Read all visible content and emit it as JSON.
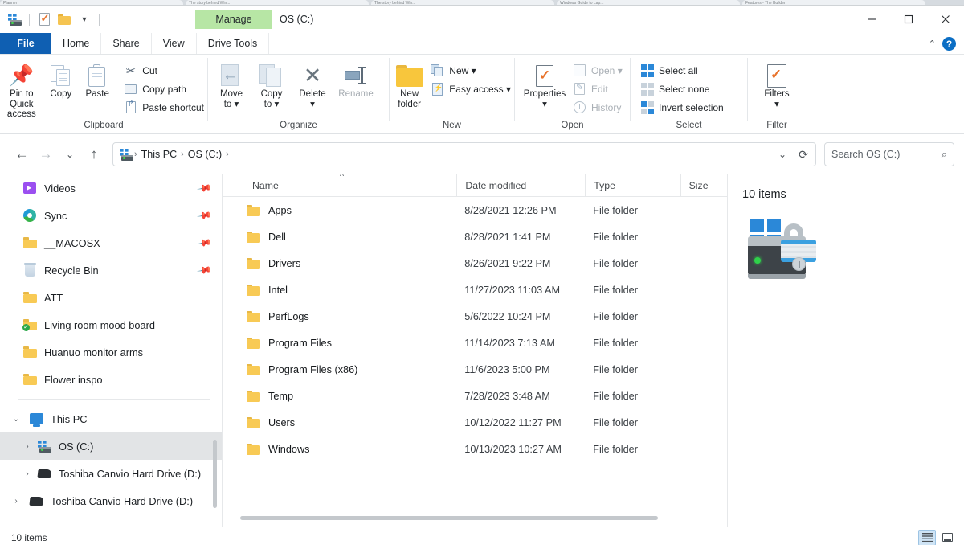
{
  "browser_tabs": [
    {
      "title": "Planner"
    },
    {
      "title": "The story behind Win..."
    },
    {
      "title": "The story behind Win..."
    },
    {
      "title": "Windows Guide to Lap..."
    },
    {
      "title": "Features - The Builder"
    }
  ],
  "window": {
    "title": "OS (C:)",
    "contextual_tab": "Manage",
    "controls": {
      "minimize": "—",
      "maximize": "☐",
      "close": "✕"
    },
    "quick_access": {
      "drive_icon": "drive-icon",
      "properties_icon": "properties-icon",
      "folder_icon": "new-folder-icon",
      "customize_icon": "chevron-down-icon"
    }
  },
  "ribbon": {
    "tabs": [
      {
        "label": "File",
        "state": "file"
      },
      {
        "label": "Home",
        "state": "active"
      },
      {
        "label": "Share",
        "state": "normal"
      },
      {
        "label": "View",
        "state": "normal"
      },
      {
        "label": "Drive Tools",
        "state": "contextual"
      }
    ],
    "collapse_icon": "chevron-up-icon",
    "help_label": "?",
    "groups": [
      {
        "label": "Clipboard",
        "big_buttons": [
          {
            "label": "Pin to Quick\naccess",
            "label_line1": "Pin to Quick",
            "label_line2": "access",
            "icon": "pin-icon",
            "disabled": false
          },
          {
            "label": "Copy",
            "icon": "copy-icon",
            "disabled": false
          },
          {
            "label": "Paste",
            "icon": "paste-icon",
            "disabled": false
          }
        ],
        "small_buttons": [
          {
            "label": "Cut",
            "icon": "scissors-icon",
            "disabled": false
          },
          {
            "label": "Copy path",
            "icon": "copy-path-icon",
            "disabled": false
          },
          {
            "label": "Paste shortcut",
            "icon": "paste-shortcut-icon",
            "disabled": false
          }
        ]
      },
      {
        "label": "Organize",
        "big_buttons": [
          {
            "label_line1": "Move",
            "label_line2": "to ▾",
            "icon": "move-to-icon",
            "disabled": false
          },
          {
            "label_line1": "Copy",
            "label_line2": "to ▾",
            "icon": "copy-to-icon",
            "disabled": false
          },
          {
            "label_line1": "Delete",
            "label_line2": "▾",
            "icon": "delete-icon",
            "disabled": false
          },
          {
            "label_line1": "Rename",
            "label_line2": "",
            "icon": "rename-icon",
            "disabled": true
          }
        ],
        "small_buttons": []
      },
      {
        "label": "New",
        "big_buttons": [
          {
            "label_line1": "New",
            "label_line2": "folder",
            "icon": "new-folder-icon",
            "disabled": false
          }
        ],
        "small_buttons": [
          {
            "label": "New ▾",
            "icon": "new-item-icon",
            "disabled": false
          },
          {
            "label": "Easy access ▾",
            "icon": "easy-access-icon",
            "disabled": false
          }
        ]
      },
      {
        "label": "Open",
        "big_buttons": [
          {
            "label_line1": "Properties",
            "label_line2": "▾",
            "icon": "properties-icon",
            "disabled": false
          }
        ],
        "small_buttons": [
          {
            "label": "Open ▾",
            "icon": "open-icon",
            "disabled": true
          },
          {
            "label": "Edit",
            "icon": "edit-icon",
            "disabled": true
          },
          {
            "label": "History",
            "icon": "history-icon",
            "disabled": true
          }
        ]
      },
      {
        "label": "Select",
        "big_buttons": [],
        "small_buttons": [
          {
            "label": "Select all",
            "icon": "select-all-icon",
            "disabled": false
          },
          {
            "label": "Select none",
            "icon": "select-none-icon",
            "disabled": false
          },
          {
            "label": "Invert selection",
            "icon": "invert-selection-icon",
            "disabled": false
          }
        ]
      },
      {
        "label": "Filter",
        "big_buttons": [
          {
            "label_line1": "Filters",
            "label_line2": "▾",
            "icon": "filters-icon",
            "disabled": false
          }
        ],
        "small_buttons": []
      }
    ]
  },
  "addressbar": {
    "back_icon": "back-arrow-icon",
    "forward_icon": "forward-arrow-icon",
    "recent_icon": "chevron-down-icon",
    "up_icon": "up-arrow-icon",
    "breadcrumbs": [
      "This PC",
      "OS (C:)"
    ],
    "dropdown_icon": "chevron-down-icon",
    "refresh_icon": "refresh-icon",
    "search_placeholder": "Search OS (C:)",
    "search_icon": "search-icon"
  },
  "sidebar": {
    "quick_items": [
      {
        "label": "Videos",
        "icon": "videos-icon",
        "pinned": true
      },
      {
        "label": "Sync",
        "icon": "sync-icon",
        "pinned": true
      },
      {
        "label": "__MACOSX",
        "icon": "folder-icon",
        "pinned": true
      },
      {
        "label": "Recycle Bin",
        "icon": "recycle-bin-icon",
        "pinned": true
      },
      {
        "label": "ATT",
        "icon": "folder-icon",
        "pinned": false
      },
      {
        "label": "Living room mood board",
        "icon": "synced-folder-icon",
        "pinned": false
      },
      {
        "label": "Huanuo monitor arms",
        "icon": "folder-icon",
        "pinned": false
      },
      {
        "label": "Flower inspo",
        "icon": "folder-icon",
        "pinned": false
      }
    ],
    "tree_items": [
      {
        "label": "This PC",
        "icon": "this-pc-icon",
        "level": 0,
        "expanded": true,
        "selected": false
      },
      {
        "label": "OS (C:)",
        "icon": "drive-icon",
        "level": 1,
        "expanded": false,
        "selected": true
      },
      {
        "label": "Toshiba Canvio Hard Drive (D:)",
        "icon": "hdd-icon",
        "level": 1,
        "expanded": false,
        "selected": false
      },
      {
        "label": "Toshiba Canvio Hard Drive (D:)",
        "icon": "hdd-icon",
        "level": 1,
        "expanded": false,
        "selected": false
      }
    ]
  },
  "filelist": {
    "columns": [
      {
        "label": "Name",
        "sorted": true,
        "sort_direction": "asc"
      },
      {
        "label": "Date modified",
        "sorted": false
      },
      {
        "label": "Type",
        "sorted": false
      },
      {
        "label": "Size",
        "sorted": false
      }
    ],
    "sort_indicator": "˄",
    "rows": [
      {
        "name": "Apps",
        "date": "8/28/2021 12:26 PM",
        "type": "File folder",
        "size": "",
        "icon": "folder-icon"
      },
      {
        "name": "Dell",
        "date": "8/28/2021 1:41 PM",
        "type": "File folder",
        "size": "",
        "icon": "folder-icon"
      },
      {
        "name": "Drivers",
        "date": "8/26/2021 9:22 PM",
        "type": "File folder",
        "size": "",
        "icon": "folder-icon"
      },
      {
        "name": "Intel",
        "date": "11/27/2023 11:03 AM",
        "type": "File folder",
        "size": "",
        "icon": "folder-icon"
      },
      {
        "name": "PerfLogs",
        "date": "5/6/2022 10:24 PM",
        "type": "File folder",
        "size": "",
        "icon": "folder-icon"
      },
      {
        "name": "Program Files",
        "date": "11/14/2023 7:13 AM",
        "type": "File folder",
        "size": "",
        "icon": "folder-icon"
      },
      {
        "name": "Program Files (x86)",
        "date": "11/6/2023 5:00 PM",
        "type": "File folder",
        "size": "",
        "icon": "folder-icon"
      },
      {
        "name": "Temp",
        "date": "7/28/2023 3:48 AM",
        "type": "File folder",
        "size": "",
        "icon": "folder-icon"
      },
      {
        "name": "Users",
        "date": "10/12/2022 11:27 PM",
        "type": "File folder",
        "size": "",
        "icon": "folder-icon"
      },
      {
        "name": "Windows",
        "date": "10/13/2023 10:27 AM",
        "type": "File folder",
        "size": "",
        "icon": "folder-icon"
      }
    ]
  },
  "details_pane": {
    "item_count": "10 items",
    "preview_icon": "bitlocker-drive-icon"
  },
  "statusbar": {
    "item_count": "10 items",
    "view_details_icon": "details-view-icon",
    "view_icons_icon": "large-icons-view-icon",
    "active_view": "details"
  },
  "colors": {
    "accent_blue": "#0f5fb2",
    "contextual_green": "#b7e6a5",
    "folder_yellow": "#f8ca55",
    "selection_gray": "#e2e4e6",
    "help_blue": "#0b6ec4"
  }
}
